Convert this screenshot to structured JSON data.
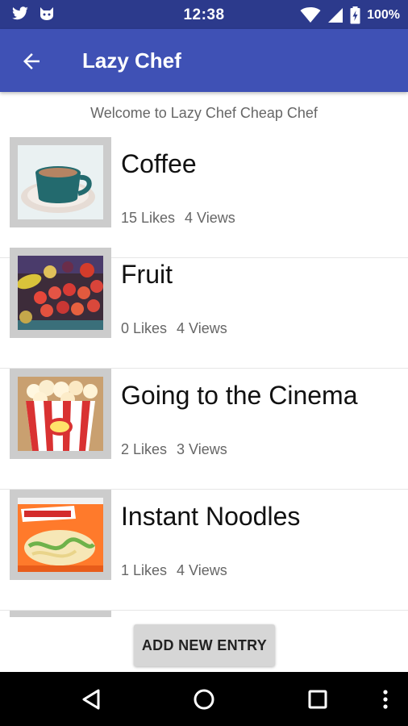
{
  "status_bar": {
    "time": "12:38",
    "battery": "100%",
    "icons": [
      "twitter-icon",
      "cat-icon",
      "wifi-icon",
      "cell-signal-icon",
      "battery-charging-icon"
    ]
  },
  "app_bar": {
    "title": "Lazy Chef",
    "back_icon": "arrow-left-icon"
  },
  "welcome_text": "Welcome to Lazy Chef Cheap Chef",
  "entries": [
    {
      "name": "Coffee",
      "likes": "15 Likes",
      "views": "4 Views",
      "image": "coffee-cup"
    },
    {
      "name": "Fruit",
      "likes": "0 Likes",
      "views": "4 Views",
      "image": "fruit-basket"
    },
    {
      "name": "Going to the Cinema",
      "likes": "2 Likes",
      "views": "3 Views",
      "image": "popcorn-box"
    },
    {
      "name": "Instant Noodles",
      "likes": "1 Likes",
      "views": "4 Views",
      "image": "noodle-packet"
    }
  ],
  "add_button": "ADD NEW ENTRY",
  "nav_bar": {
    "icons": [
      "back-triangle-icon",
      "home-circle-icon",
      "recents-square-icon",
      "more-vert-icon"
    ]
  },
  "colors": {
    "status_bar": "#2c3a8c",
    "app_bar": "#3f51b5",
    "button": "#d6d6d6"
  }
}
